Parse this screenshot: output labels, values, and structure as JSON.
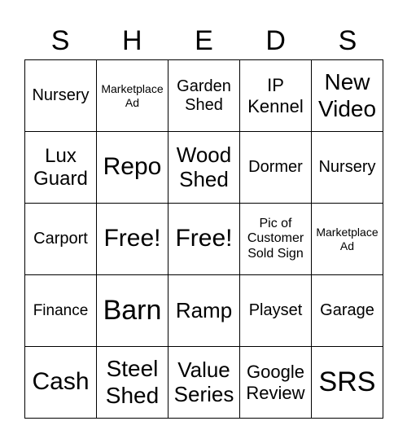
{
  "header": [
    "S",
    "H",
    "E",
    "D",
    "S"
  ],
  "cells": [
    "Nursery",
    "Marketplace\nAd",
    "Garden\nShed",
    "IP\nKennel",
    "New\nVideo",
    "Lux\nGuard",
    "Repo",
    "Wood\nShed",
    "Dormer",
    "Nursery",
    "Carport",
    "Free!",
    "Free!",
    "Pic of\nCustomer\nSold Sign",
    "Marketplace\nAd",
    "Finance",
    "Barn",
    "Ramp",
    "Playset",
    "Garage",
    "Cash",
    "Steel\nShed",
    "Value\nSeries",
    "Google\nReview",
    "SRS"
  ]
}
